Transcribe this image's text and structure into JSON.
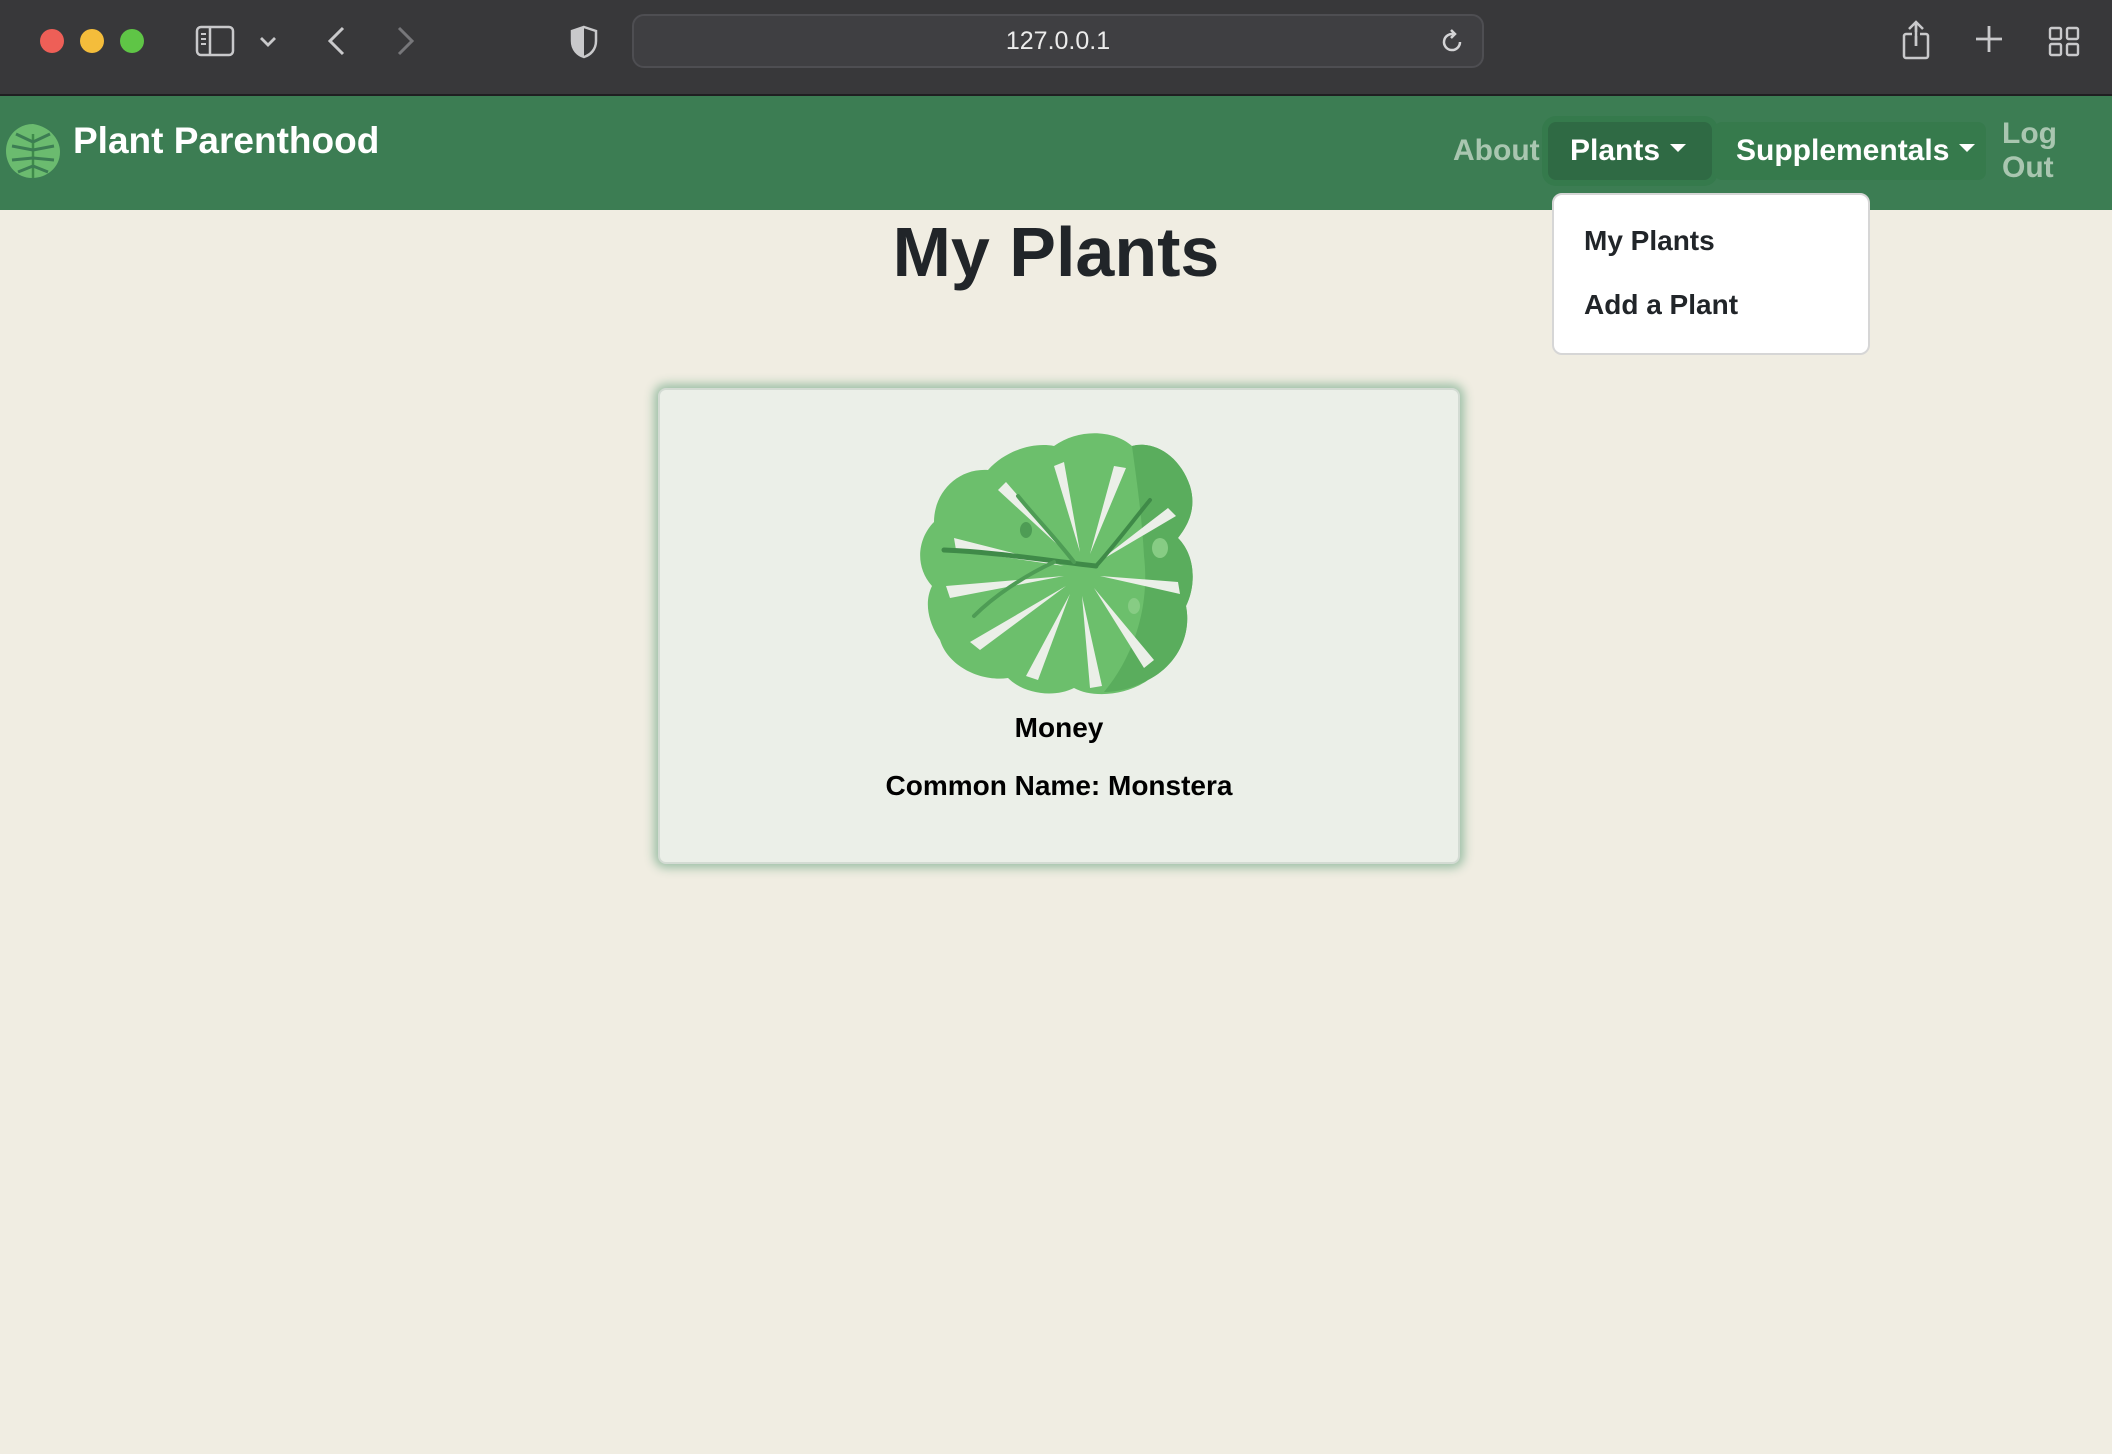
{
  "browser": {
    "url": "127.0.0.1",
    "icons": [
      "sidebar-icon",
      "chevron-down-icon",
      "back-icon",
      "forward-icon",
      "shield-icon",
      "reload-icon",
      "share-icon",
      "plus-icon",
      "tab-overview-icon"
    ]
  },
  "navbar": {
    "brand": "Plant Parenthood",
    "links": {
      "about": "About",
      "plants": "Plants",
      "supplementals": "Supplementals",
      "logout": "Log Out"
    },
    "colors": {
      "bar": "#3c7d53",
      "active": "#2f6a44"
    }
  },
  "plants_menu": {
    "items": [
      "My Plants",
      "Add a Plant"
    ]
  },
  "main": {
    "title": "My Plants",
    "plants": [
      {
        "name": "Money",
        "common_name": "Common Name: Monstera",
        "icon": "monstera-leaf-icon"
      }
    ]
  },
  "colors": {
    "page_bg": "#f0ede2",
    "card_bg": "#ebefe8"
  }
}
